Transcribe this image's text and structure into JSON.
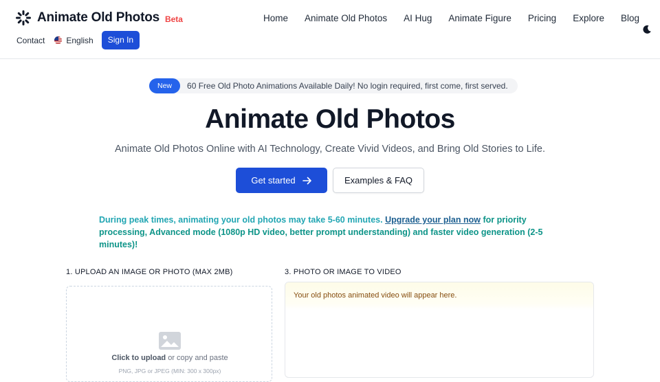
{
  "brand": {
    "name": "Animate Old Photos",
    "beta": "Beta"
  },
  "nav": {
    "items": [
      "Home",
      "Animate Old Photos",
      "AI Hug",
      "Animate Figure",
      "Pricing",
      "Explore",
      "Blog"
    ]
  },
  "subnav": {
    "contact": "Contact",
    "language": "English",
    "signin": "Sign In"
  },
  "announcement": {
    "badge": "New",
    "message": "60 Free Old Photo Animations Available Daily! No login required, first come, first served."
  },
  "hero": {
    "title": "Animate Old Photos",
    "subtitle": "Animate Old Photos Online with AI Technology, Create Vivid Videos, and Bring Old Stories to Life.",
    "primary_cta": "Get started",
    "secondary_cta": "Examples & FAQ"
  },
  "notice": {
    "part1": "During peak times, animating your old photos may take 5-60 minutes. ",
    "link": "Upgrade your plan now",
    "part2": " for priority processing, Advanced mode (1080p HD video, better prompt understanding) and faster video generation (2-5 minutes)!"
  },
  "upload": {
    "label": "1. UPLOAD AN IMAGE OR PHOTO (MAX 2MB)",
    "click": "Click to upload",
    "or_text": " or copy and paste",
    "hint": "PNG, JPG or JPEG (MIN: 300 x 300px)"
  },
  "video": {
    "label": "3. PHOTO OR IMAGE TO VIDEO",
    "placeholder": "Your old photos animated video will appear here."
  },
  "colors": {
    "accent": "#1d4ed8",
    "beta": "#ef4444",
    "notice_teal": "#22a6b3",
    "notice_green": "#0d9488"
  },
  "icons": {
    "logo": "sparkle-burst-icon",
    "theme": "moon-icon",
    "arrow": "arrow-right-icon",
    "upload": "image-icon",
    "flag": "us-flag-icon"
  }
}
